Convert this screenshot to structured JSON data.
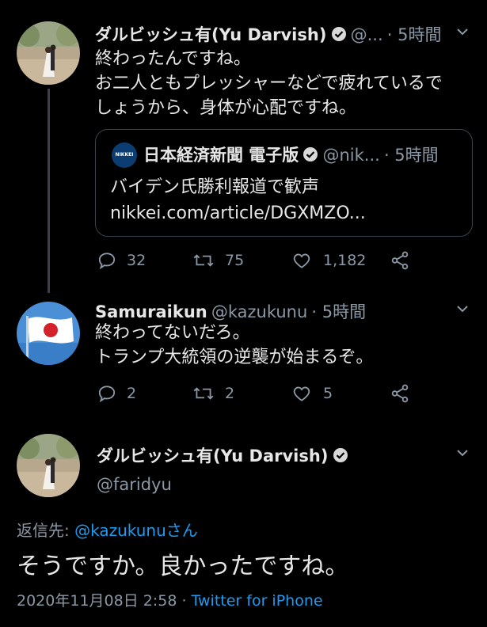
{
  "tweet1": {
    "name": "ダルビッシュ有(Yu Darvish)",
    "handle": "@...",
    "time": "· 5時間",
    "text": [
      "終わったんですね。",
      "お二人ともプレッシャーなどで疲れているで",
      "しょうから、身体が心配ですね。"
    ],
    "quote": {
      "name": "日本経済新聞 電子版",
      "handle": "@nik...",
      "time": "· 5時間",
      "title": "バイデン氏勝利報道で歓声",
      "link": "nikkei.com/article/DGXMZO...",
      "logo_text": "NIKKEI"
    },
    "replies": "32",
    "retweets": "75",
    "likes": "1,182"
  },
  "tweet2": {
    "name": "Samuraikun",
    "handle": "@kazukunu",
    "time": "· 5時間",
    "text": [
      "終わってないだろ。",
      "トランプ大統領の逆襲が始まるぞ。"
    ],
    "replies": "2",
    "retweets": "2",
    "likes": "5"
  },
  "main_tweet": {
    "name": "ダルビッシュ有(Yu Darvish)",
    "handle": "@faridyu",
    "reply_prefix": "返信先: ",
    "reply_to": "@kazukunuさん",
    "text": "そうですか。良かったですね。",
    "timestamp": "2020年11月08日 2:58",
    "separator": " · ",
    "client": "Twitter for iPhone"
  },
  "icons": [
    "verified-icon",
    "chevron-down-icon",
    "reply-icon",
    "retweet-icon",
    "like-icon",
    "share-icon"
  ],
  "colors": {
    "background": "#000000",
    "link": "#1d9bf0",
    "secondary": "#8b98a5"
  }
}
